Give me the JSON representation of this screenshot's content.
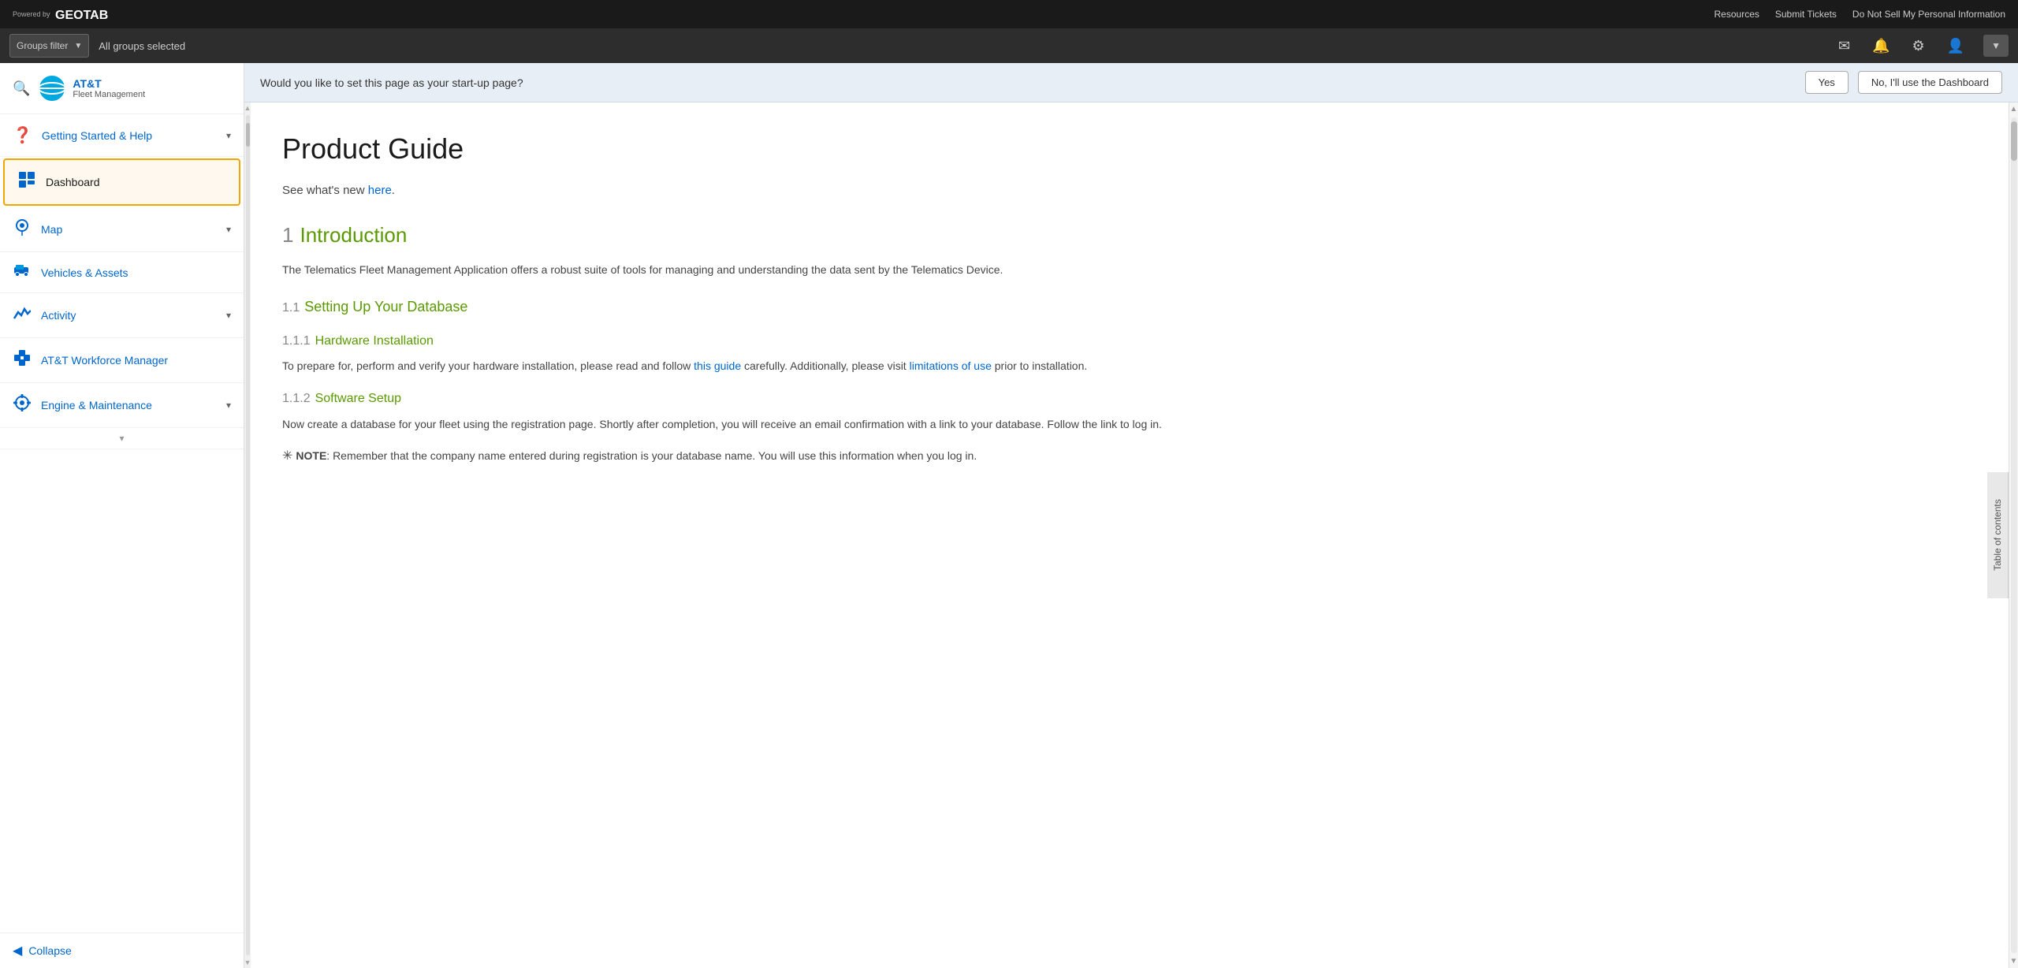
{
  "topbar": {
    "powered_by": "Powered by",
    "brand": "GEOTAB",
    "nav_links": [
      "Resources",
      "Submit Tickets",
      "Do Not Sell My Personal Information"
    ]
  },
  "groups_bar": {
    "filter_label": "Groups filter",
    "selected_text": "All groups selected"
  },
  "sidebar": {
    "brand_name": "AT&T",
    "brand_subtitle": "Fleet Management",
    "nav_items": [
      {
        "id": "getting-started",
        "label": "Getting Started & Help",
        "icon": "❓",
        "has_chevron": true,
        "active": false
      },
      {
        "id": "dashboard",
        "label": "Dashboard",
        "icon": "📊",
        "has_chevron": false,
        "active": true
      },
      {
        "id": "map",
        "label": "Map",
        "icon": "🗺",
        "has_chevron": true,
        "active": false
      },
      {
        "id": "vehicles",
        "label": "Vehicles & Assets",
        "icon": "🚛",
        "has_chevron": false,
        "active": false
      },
      {
        "id": "activity",
        "label": "Activity",
        "icon": "📈",
        "has_chevron": true,
        "active": false
      },
      {
        "id": "workforce",
        "label": "AT&T Workforce Manager",
        "icon": "🧩",
        "has_chevron": false,
        "active": false
      },
      {
        "id": "engine",
        "label": "Engine & Maintenance",
        "icon": "🎥",
        "has_chevron": true,
        "active": false
      }
    ],
    "collapse_label": "Collapse"
  },
  "startup_banner": {
    "question": "Would you like to set this page as your start-up page?",
    "yes_label": "Yes",
    "no_label": "No, I'll use the Dashboard"
  },
  "document": {
    "title": "Product Guide",
    "subtitle_text": "See what's new ",
    "subtitle_link": "here",
    "subtitle_suffix": ".",
    "toc_label": "Table of contents",
    "sections": [
      {
        "number": "1",
        "title": "Introduction",
        "body": "The Telematics Fleet Management Application offers a robust suite of tools for managing and understanding the data sent by the Telematics Device.",
        "subsections": [
          {
            "number": "1.1",
            "title": "Setting Up Your Database",
            "items": [
              {
                "number": "1.1.1",
                "title": "Hardware Installation",
                "body_prefix": "To prepare for, perform and verify your hardware installation, please read and follow ",
                "link1_text": "this guide",
                "body_middle": " carefully. Additionally, please visit ",
                "link2_text": "limitations of use",
                "body_suffix": " prior to installation."
              },
              {
                "number": "1.1.2",
                "title": "Software Setup",
                "body": "Now create a database for your fleet using the registration page. Shortly after completion, you will receive an email confirmation with a link to your database. Follow the link to log in."
              }
            ]
          }
        ]
      }
    ],
    "note": {
      "star": "✳",
      "bold": "NOTE",
      "text": ": Remember that the company name entered during registration is your database name. You will use this information when you log in."
    }
  }
}
